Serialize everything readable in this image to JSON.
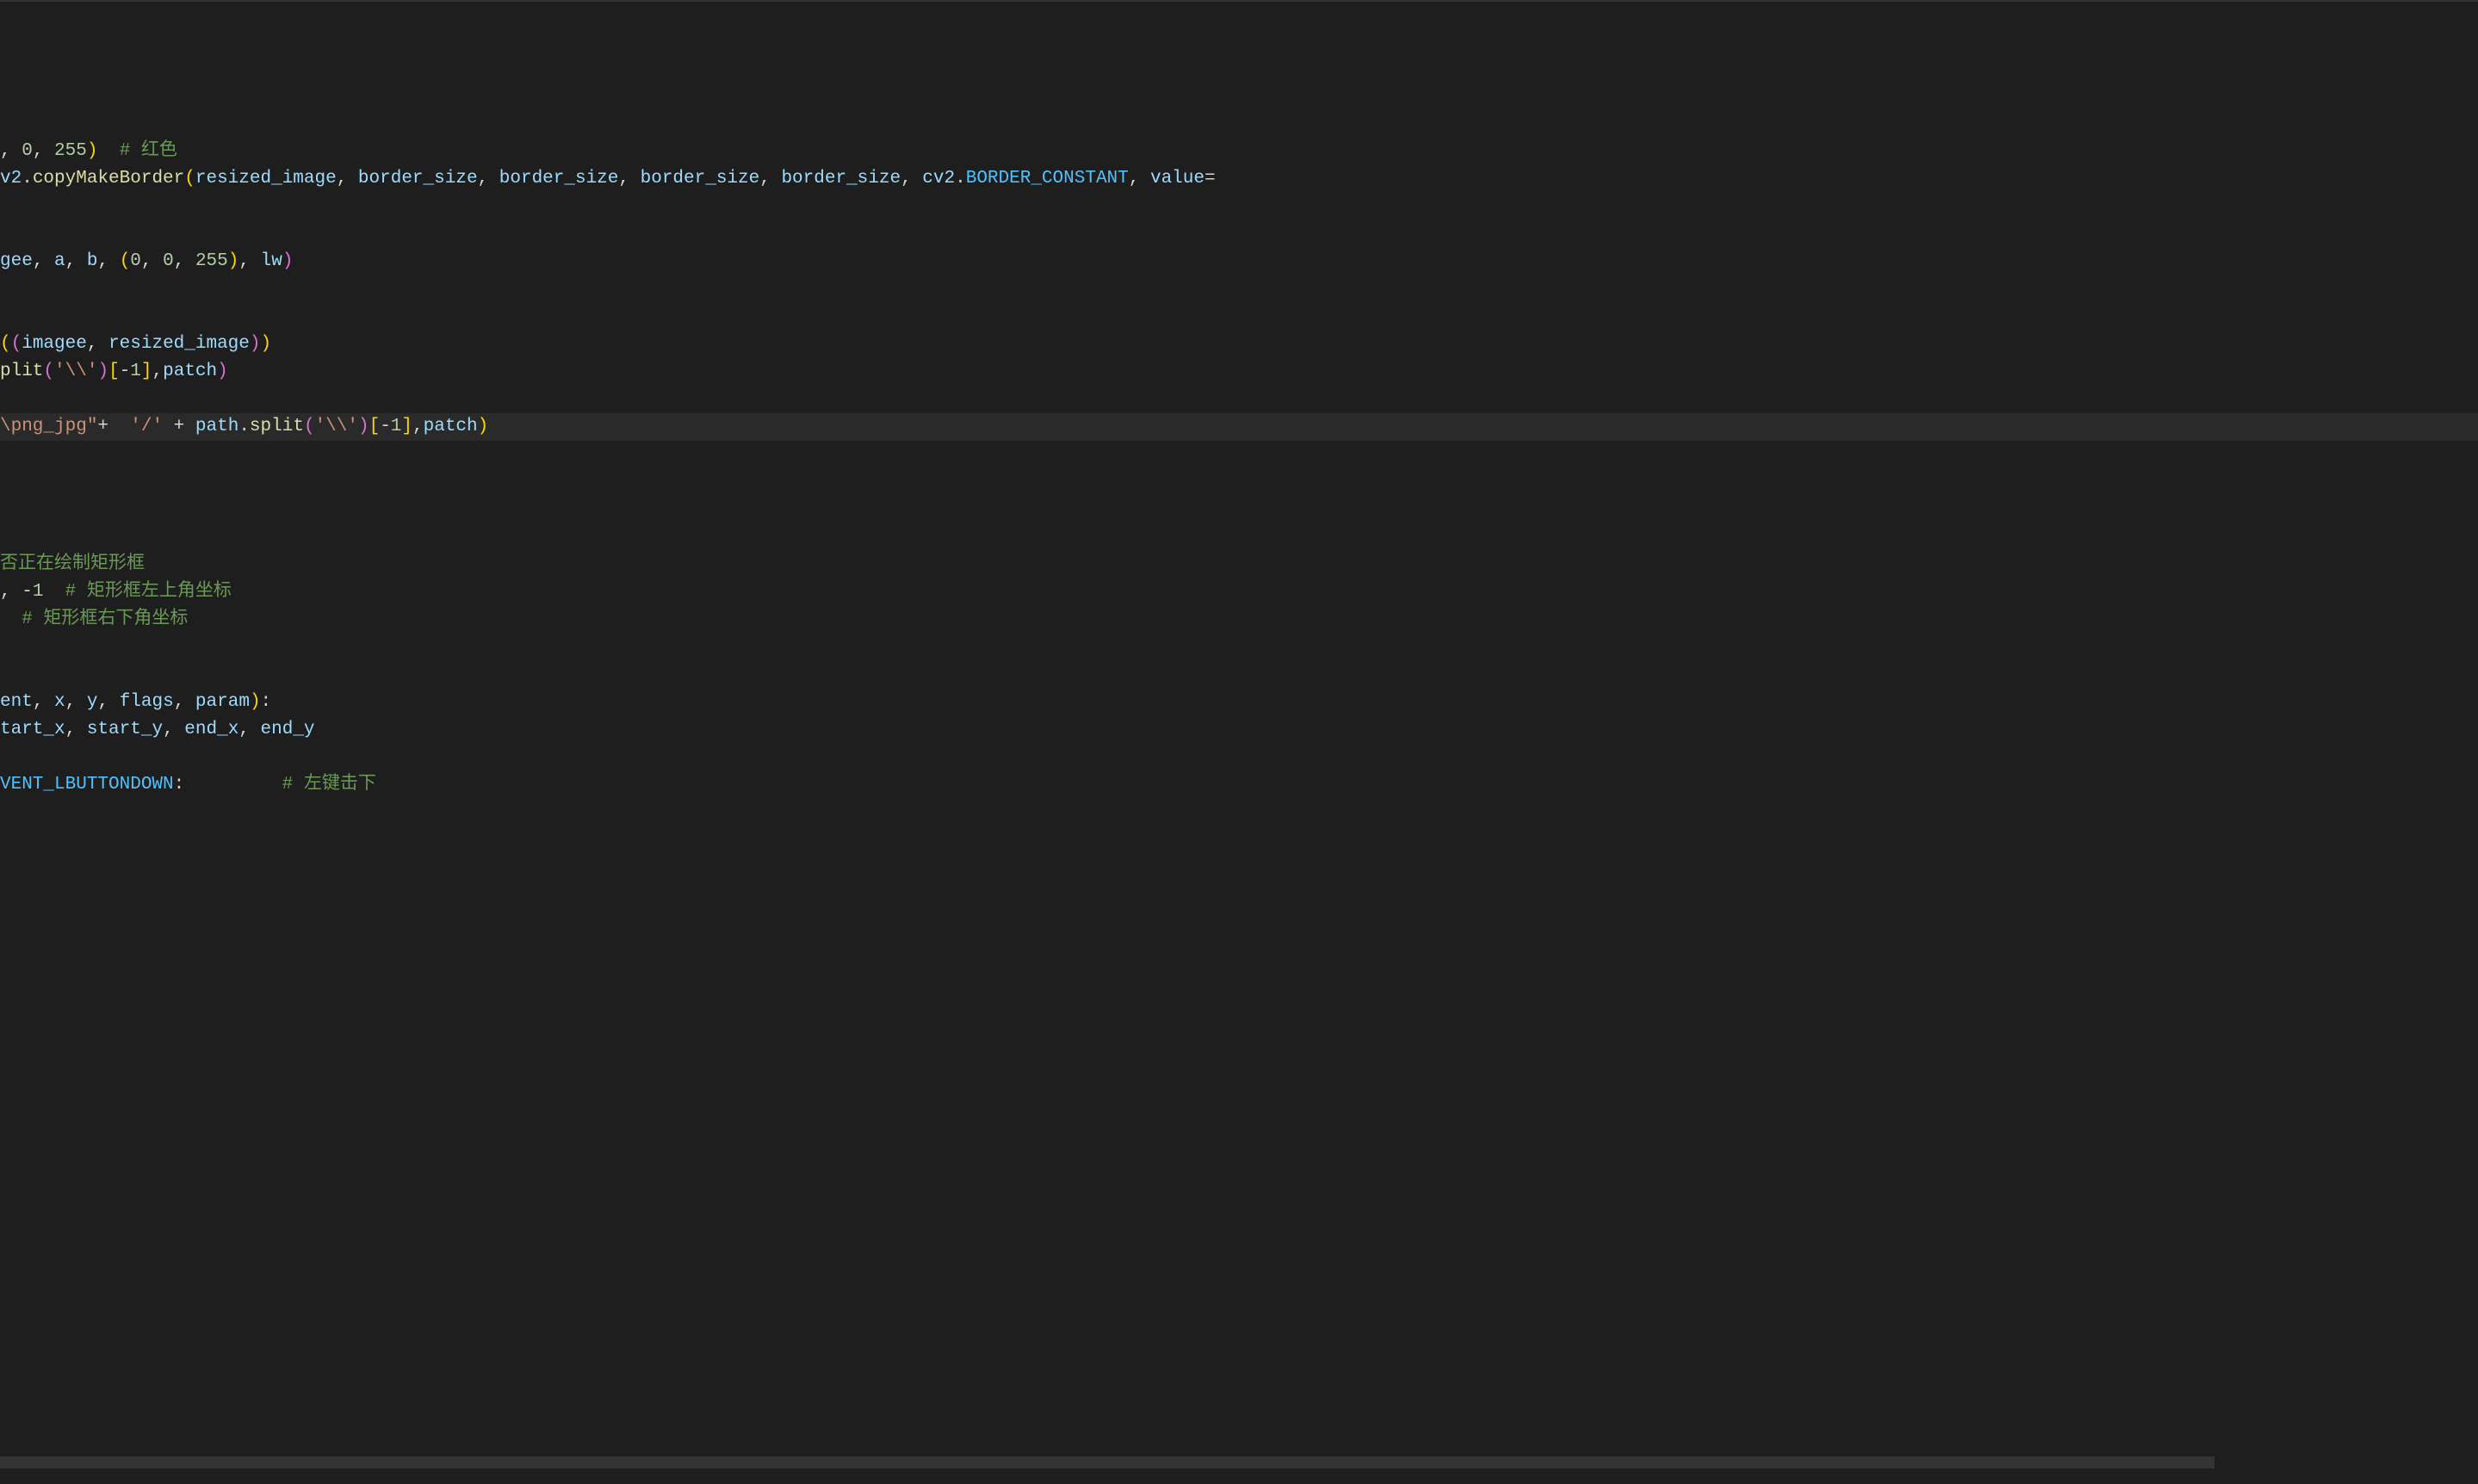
{
  "lines": [
    {
      "tokens": [
        {
          "cls": "tok-plain",
          "t": ""
        }
      ],
      "highlighted": false
    },
    {
      "tokens": [
        {
          "cls": "tok-plain",
          "t": ""
        }
      ],
      "highlighted": false
    },
    {
      "tokens": [
        {
          "cls": "tok-plain",
          "t": ", "
        },
        {
          "cls": "tok-num",
          "t": "0"
        },
        {
          "cls": "tok-plain",
          "t": ", "
        },
        {
          "cls": "tok-num",
          "t": "255"
        },
        {
          "cls": "tok-paren-y",
          "t": ")"
        },
        {
          "cls": "tok-plain",
          "t": "  "
        },
        {
          "cls": "tok-comment",
          "t": "# 红色"
        }
      ],
      "highlighted": false
    },
    {
      "tokens": [
        {
          "cls": "tok-var",
          "t": "v2"
        },
        {
          "cls": "tok-plain",
          "t": "."
        },
        {
          "cls": "tok-func",
          "t": "copyMakeBorder"
        },
        {
          "cls": "tok-paren-y",
          "t": "("
        },
        {
          "cls": "tok-var",
          "t": "resized_image"
        },
        {
          "cls": "tok-plain",
          "t": ", "
        },
        {
          "cls": "tok-var",
          "t": "border_size"
        },
        {
          "cls": "tok-plain",
          "t": ", "
        },
        {
          "cls": "tok-var",
          "t": "border_size"
        },
        {
          "cls": "tok-plain",
          "t": ", "
        },
        {
          "cls": "tok-var",
          "t": "border_size"
        },
        {
          "cls": "tok-plain",
          "t": ", "
        },
        {
          "cls": "tok-var",
          "t": "border_size"
        },
        {
          "cls": "tok-plain",
          "t": ", "
        },
        {
          "cls": "tok-var",
          "t": "cv2"
        },
        {
          "cls": "tok-plain",
          "t": "."
        },
        {
          "cls": "tok-const",
          "t": "BORDER_CONSTANT"
        },
        {
          "cls": "tok-plain",
          "t": ", "
        },
        {
          "cls": "tok-var",
          "t": "value"
        },
        {
          "cls": "tok-op",
          "t": "="
        }
      ],
      "highlighted": false
    },
    {
      "tokens": [
        {
          "cls": "tok-plain",
          "t": ""
        }
      ],
      "highlighted": false
    },
    {
      "tokens": [
        {
          "cls": "tok-plain",
          "t": ""
        }
      ],
      "highlighted": false
    },
    {
      "tokens": [
        {
          "cls": "tok-var",
          "t": "gee"
        },
        {
          "cls": "tok-plain",
          "t": ", "
        },
        {
          "cls": "tok-var",
          "t": "a"
        },
        {
          "cls": "tok-plain",
          "t": ", "
        },
        {
          "cls": "tok-var",
          "t": "b"
        },
        {
          "cls": "tok-plain",
          "t": ", "
        },
        {
          "cls": "tok-paren-y",
          "t": "("
        },
        {
          "cls": "tok-num",
          "t": "0"
        },
        {
          "cls": "tok-plain",
          "t": ", "
        },
        {
          "cls": "tok-num",
          "t": "0"
        },
        {
          "cls": "tok-plain",
          "t": ", "
        },
        {
          "cls": "tok-num",
          "t": "255"
        },
        {
          "cls": "tok-paren-y",
          "t": ")"
        },
        {
          "cls": "tok-plain",
          "t": ", "
        },
        {
          "cls": "tok-var",
          "t": "lw"
        },
        {
          "cls": "tok-paren-p",
          "t": ")"
        }
      ],
      "highlighted": false
    },
    {
      "tokens": [
        {
          "cls": "tok-plain",
          "t": ""
        }
      ],
      "highlighted": false
    },
    {
      "tokens": [
        {
          "cls": "tok-plain",
          "t": ""
        }
      ],
      "highlighted": false
    },
    {
      "tokens": [
        {
          "cls": "tok-paren-y",
          "t": "("
        },
        {
          "cls": "tok-paren-p",
          "t": "("
        },
        {
          "cls": "tok-var",
          "t": "imagee"
        },
        {
          "cls": "tok-plain",
          "t": ", "
        },
        {
          "cls": "tok-var",
          "t": "resized_image"
        },
        {
          "cls": "tok-paren-p",
          "t": ")"
        },
        {
          "cls": "tok-paren-y",
          "t": ")"
        }
      ],
      "highlighted": false
    },
    {
      "tokens": [
        {
          "cls": "tok-func",
          "t": "plit"
        },
        {
          "cls": "tok-paren-p",
          "t": "("
        },
        {
          "cls": "tok-str",
          "t": "'\\\\'"
        },
        {
          "cls": "tok-paren-p",
          "t": ")"
        },
        {
          "cls": "tok-paren-y",
          "t": "["
        },
        {
          "cls": "tok-op",
          "t": "-"
        },
        {
          "cls": "tok-num",
          "t": "1"
        },
        {
          "cls": "tok-paren-y",
          "t": "]"
        },
        {
          "cls": "tok-plain",
          "t": ","
        },
        {
          "cls": "tok-var",
          "t": "patch"
        },
        {
          "cls": "tok-paren-p",
          "t": ")"
        }
      ],
      "highlighted": false
    },
    {
      "tokens": [
        {
          "cls": "tok-plain",
          "t": ""
        }
      ],
      "highlighted": false
    },
    {
      "tokens": [
        {
          "cls": "tok-str",
          "t": "\\png_jpg\""
        },
        {
          "cls": "tok-op",
          "t": "+"
        },
        {
          "cls": "tok-plain",
          "t": "  "
        },
        {
          "cls": "tok-str",
          "t": "'/'"
        },
        {
          "cls": "tok-plain",
          "t": " "
        },
        {
          "cls": "tok-op",
          "t": "+"
        },
        {
          "cls": "tok-plain",
          "t": " "
        },
        {
          "cls": "tok-var",
          "t": "path"
        },
        {
          "cls": "tok-plain",
          "t": "."
        },
        {
          "cls": "tok-func",
          "t": "split"
        },
        {
          "cls": "tok-paren-p",
          "t": "("
        },
        {
          "cls": "tok-str",
          "t": "'\\\\'"
        },
        {
          "cls": "tok-paren-p",
          "t": ")"
        },
        {
          "cls": "tok-paren-y",
          "t": "["
        },
        {
          "cls": "tok-op",
          "t": "-"
        },
        {
          "cls": "tok-num",
          "t": "1"
        },
        {
          "cls": "tok-paren-y",
          "t": "]"
        },
        {
          "cls": "tok-plain",
          "t": ","
        },
        {
          "cls": "tok-var",
          "t": "patch"
        },
        {
          "cls": "tok-paren-y",
          "t": ")"
        }
      ],
      "highlighted": true
    },
    {
      "tokens": [
        {
          "cls": "tok-plain",
          "t": ""
        }
      ],
      "highlighted": false
    },
    {
      "tokens": [
        {
          "cls": "tok-plain",
          "t": ""
        }
      ],
      "highlighted": false
    },
    {
      "tokens": [
        {
          "cls": "tok-plain",
          "t": ""
        }
      ],
      "highlighted": false
    },
    {
      "tokens": [
        {
          "cls": "tok-plain",
          "t": ""
        }
      ],
      "highlighted": false
    },
    {
      "tokens": [
        {
          "cls": "tok-comment",
          "t": "否正在绘制矩形框"
        }
      ],
      "highlighted": false
    },
    {
      "tokens": [
        {
          "cls": "tok-plain",
          "t": ", "
        },
        {
          "cls": "tok-op",
          "t": "-"
        },
        {
          "cls": "tok-num",
          "t": "1"
        },
        {
          "cls": "tok-plain",
          "t": "  "
        },
        {
          "cls": "tok-comment",
          "t": "# 矩形框左上角坐标"
        }
      ],
      "highlighted": false
    },
    {
      "tokens": [
        {
          "cls": "tok-plain",
          "t": "  "
        },
        {
          "cls": "tok-comment",
          "t": "# 矩形框右下角坐标"
        }
      ],
      "highlighted": false
    },
    {
      "tokens": [
        {
          "cls": "tok-plain",
          "t": ""
        }
      ],
      "highlighted": false
    },
    {
      "tokens": [
        {
          "cls": "tok-plain",
          "t": ""
        }
      ],
      "highlighted": false
    },
    {
      "tokens": [
        {
          "cls": "tok-var",
          "t": "ent"
        },
        {
          "cls": "tok-plain",
          "t": ", "
        },
        {
          "cls": "tok-var",
          "t": "x"
        },
        {
          "cls": "tok-plain",
          "t": ", "
        },
        {
          "cls": "tok-var",
          "t": "y"
        },
        {
          "cls": "tok-plain",
          "t": ", "
        },
        {
          "cls": "tok-var",
          "t": "flags"
        },
        {
          "cls": "tok-plain",
          "t": ", "
        },
        {
          "cls": "tok-var",
          "t": "param"
        },
        {
          "cls": "tok-paren-y",
          "t": ")"
        },
        {
          "cls": "tok-plain",
          "t": ":"
        }
      ],
      "highlighted": false
    },
    {
      "tokens": [
        {
          "cls": "tok-var",
          "t": "tart_x"
        },
        {
          "cls": "tok-plain",
          "t": ", "
        },
        {
          "cls": "tok-var",
          "t": "start_y"
        },
        {
          "cls": "tok-plain",
          "t": ", "
        },
        {
          "cls": "tok-var",
          "t": "end_x"
        },
        {
          "cls": "tok-plain",
          "t": ", "
        },
        {
          "cls": "tok-var",
          "t": "end_y"
        }
      ],
      "highlighted": false
    },
    {
      "tokens": [
        {
          "cls": "tok-plain",
          "t": ""
        }
      ],
      "highlighted": false
    },
    {
      "tokens": [
        {
          "cls": "tok-const",
          "t": "VENT_LBUTTONDOWN"
        },
        {
          "cls": "tok-plain",
          "t": ":         "
        },
        {
          "cls": "tok-comment",
          "t": "# 左键击下"
        }
      ],
      "highlighted": false
    }
  ]
}
